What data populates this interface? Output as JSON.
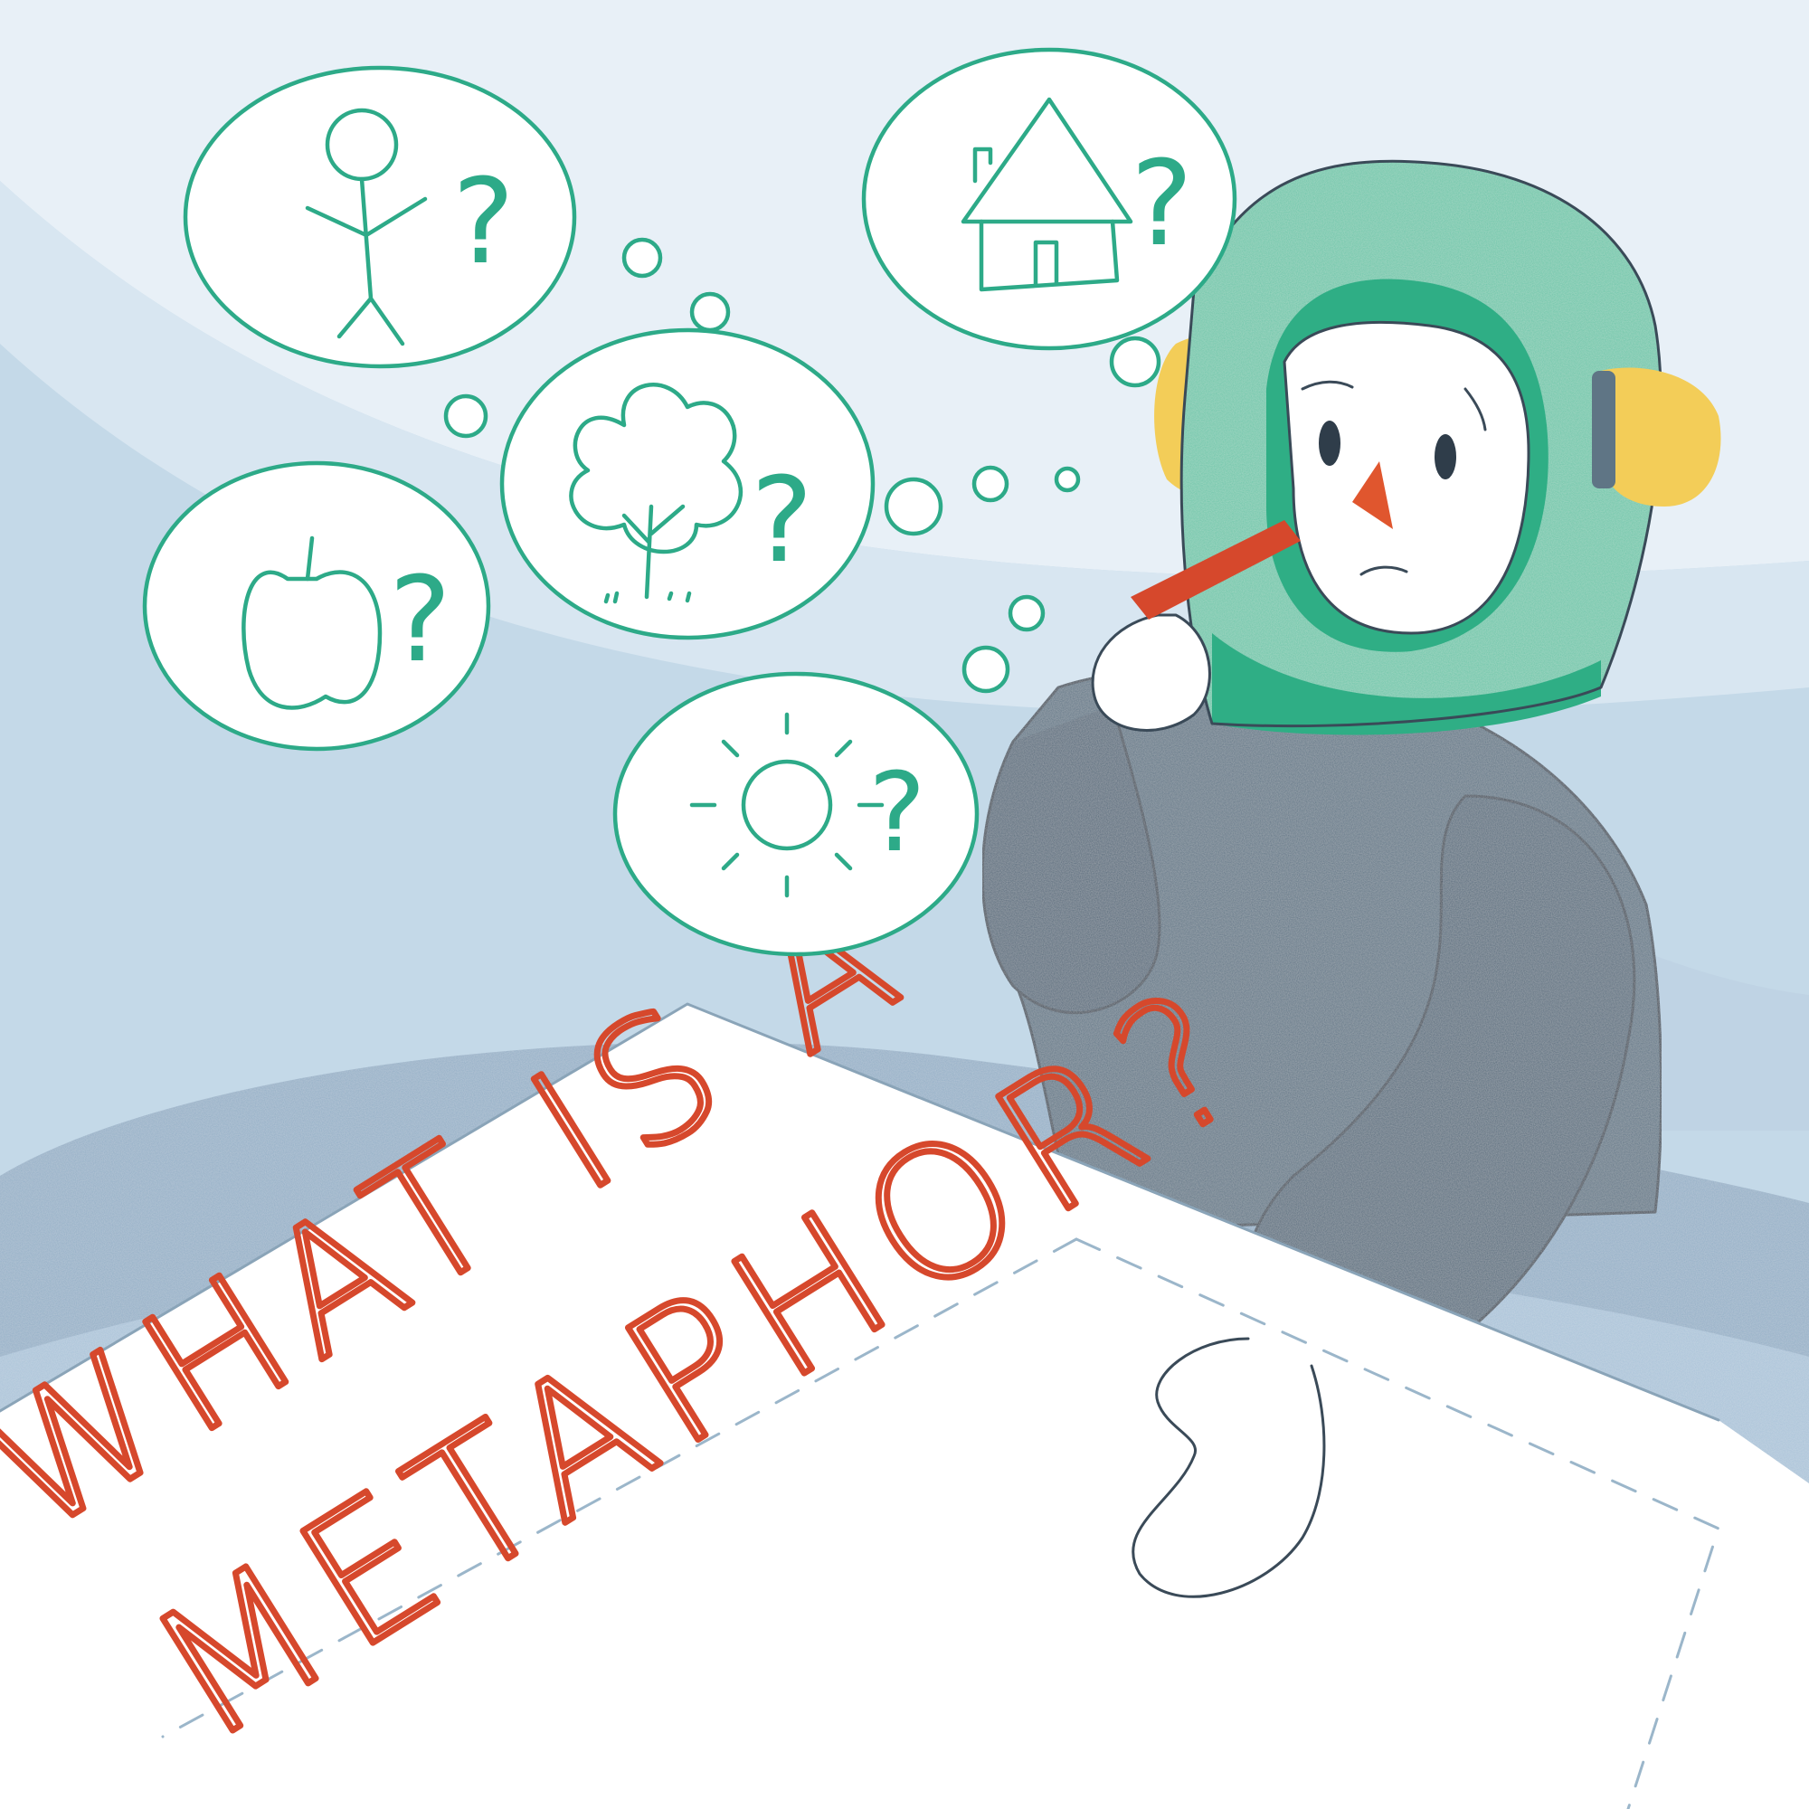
{
  "headline": {
    "line1": "WHAT IS A",
    "line2": "METAPHOR?"
  },
  "thought_bubbles": [
    {
      "subject": "stick figure",
      "mark": "?"
    },
    {
      "subject": "apple",
      "mark": "?"
    },
    {
      "subject": "tree",
      "mark": "?"
    },
    {
      "subject": "sun",
      "mark": "?"
    },
    {
      "subject": "house",
      "mark": "?"
    }
  ],
  "colors": {
    "sky_light": "#e6eff6",
    "sky_band": "#c9dcea",
    "table": "#9db8d0",
    "paper": "#ffffff",
    "headline": "#d6482c",
    "bubble_line": "#2daa88",
    "helmet": "#6cc6a9",
    "helmet_dark": "#2fae85",
    "earmuff": "#f3cd58",
    "suit": "#5f7585",
    "pen": "#d6482c",
    "nose": "#e0562e"
  }
}
